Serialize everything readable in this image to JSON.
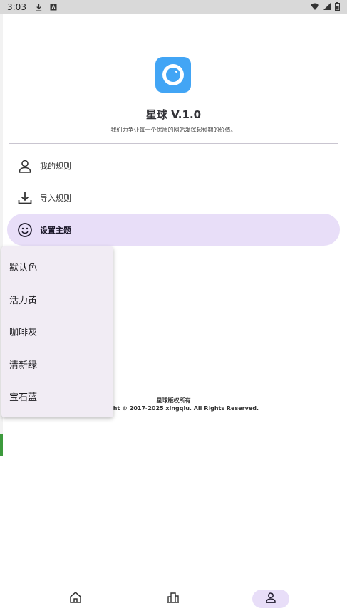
{
  "status_bar": {
    "time": "3:03"
  },
  "app": {
    "title": "星球 V.1.0",
    "subtitle": "我们力争让每一个优质的网站发挥超预期的价值。"
  },
  "menu": [
    {
      "label": "我的规则",
      "icon": "person-icon"
    },
    {
      "label": "导入规则",
      "icon": "download-icon"
    },
    {
      "label": "设置主题",
      "icon": "smiley-icon",
      "active": true
    }
  ],
  "theme_options": [
    "默认色",
    "活力黄",
    "咖啡灰",
    "清新绿",
    "宝石蓝"
  ],
  "footer": {
    "line1": "星球版权所有",
    "line2": "Copyright © 2017-2025 xingqiu. All Rights Reserved."
  },
  "bottom_nav": [
    {
      "name": "home",
      "icon": "home-icon"
    },
    {
      "name": "explore",
      "icon": "buildings-icon"
    },
    {
      "name": "profile",
      "icon": "person-icon",
      "active": true
    }
  ],
  "colors": {
    "accent": "#e8def8",
    "logo": "#42a5f5",
    "menu_bg": "#f1ecf4"
  }
}
